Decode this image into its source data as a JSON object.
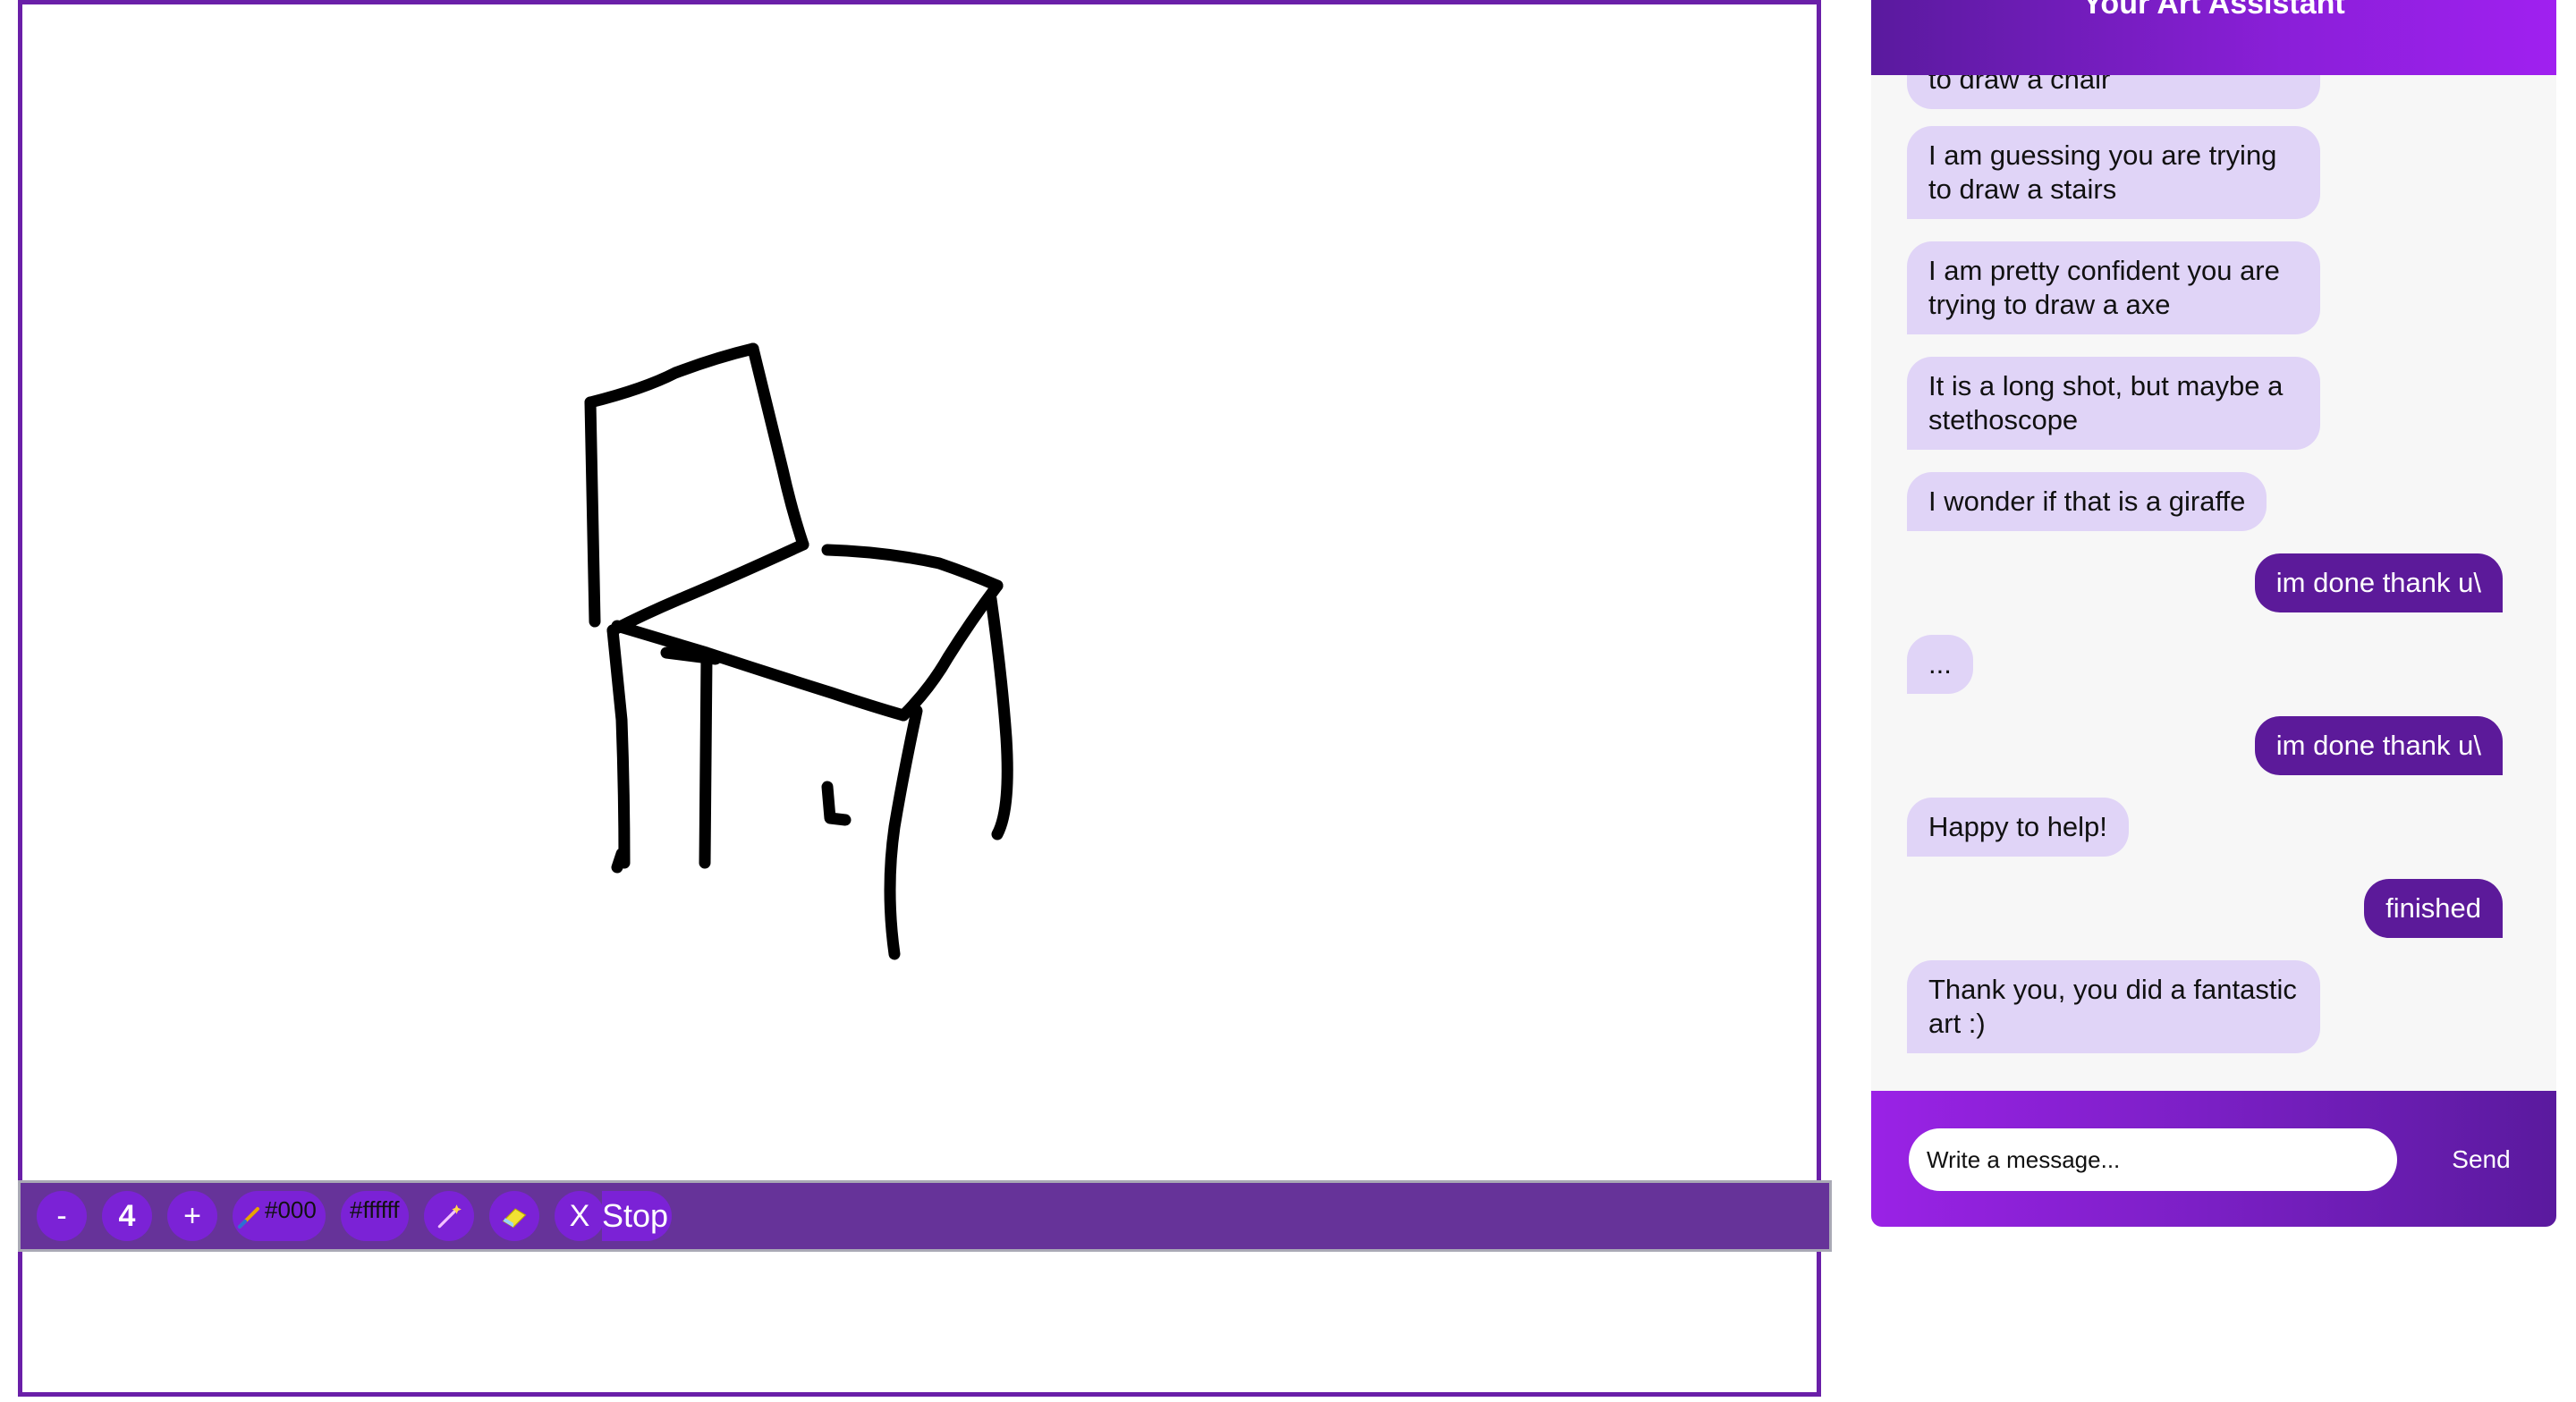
{
  "toolbar": {
    "minus_label": "-",
    "brush_size": "4",
    "plus_label": "+",
    "pen_color_label": "#000",
    "bg_color_label": "#ffffff",
    "magic_icon": "magic-wand-icon",
    "eraser_icon": "eraser-icon",
    "clear_label": "X",
    "stop_label": "Stop"
  },
  "chat": {
    "title": "Your Art Assistant",
    "messages": [
      {
        "role": "bot",
        "text": "to draw a chair"
      },
      {
        "role": "bot",
        "text": "I am guessing you are trying to draw a stairs"
      },
      {
        "role": "bot",
        "text": "I am pretty confident you are trying to draw a axe"
      },
      {
        "role": "bot",
        "text": "It is a long shot, but maybe a stethoscope"
      },
      {
        "role": "bot",
        "text": "I wonder if that is a giraffe"
      },
      {
        "role": "user",
        "text": "im done thank u\\"
      },
      {
        "role": "bot",
        "text": "..."
      },
      {
        "role": "user",
        "text": "im done thank u\\"
      },
      {
        "role": "bot",
        "text": "Happy to help!"
      },
      {
        "role": "user",
        "text": "finished"
      },
      {
        "role": "bot",
        "text": "Thank you, you did a fantastic art :)"
      }
    ],
    "input_placeholder": "Write a message...",
    "send_label": "Send"
  },
  "colors": {
    "accent": "#7b22d6",
    "toolbar_bg": "#663399",
    "frame_border": "#6a1fa8",
    "bot_bubble": "#e0d4f7",
    "user_bubble": "#5c1a9a"
  }
}
